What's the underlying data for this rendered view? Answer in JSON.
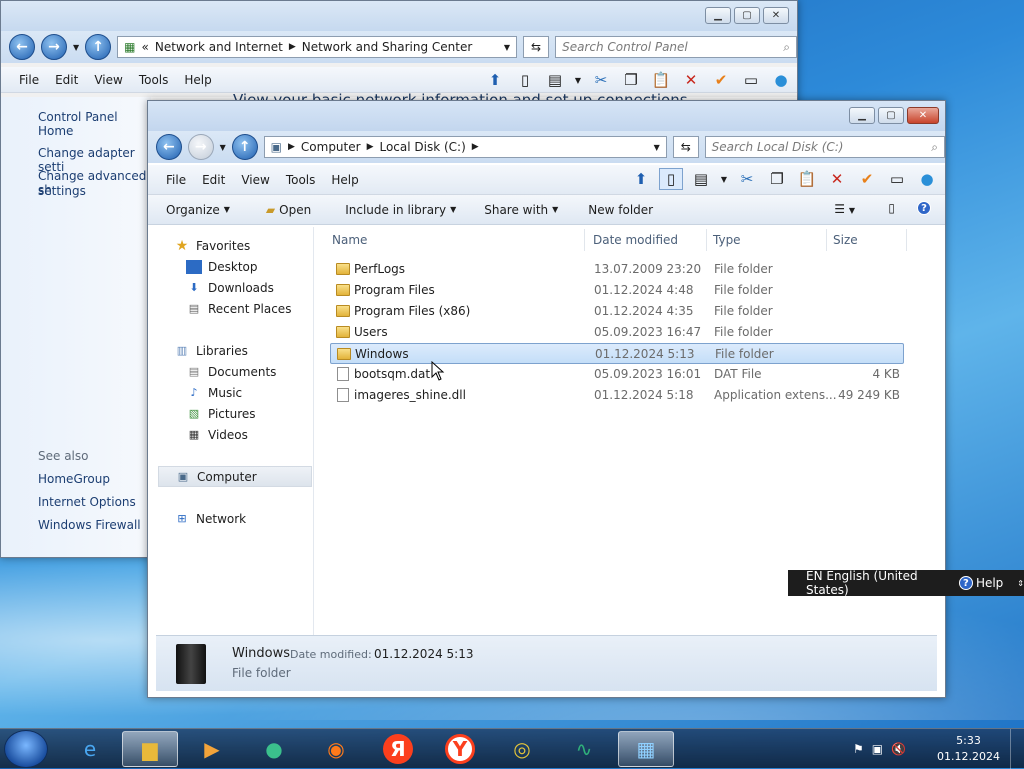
{
  "control_panel": {
    "breadcrumb": [
      "Network and Internet",
      "Network and Sharing Center"
    ],
    "breadcrumb_prefix": "«",
    "search_placeholder": "Search Control Panel",
    "menu": [
      "File",
      "Edit",
      "View",
      "Tools",
      "Help"
    ],
    "heading_partial": "View your basic network information and set up connections",
    "left_links": [
      "Control Panel Home",
      "Change adapter setti",
      "Change advanced sh",
      "settings"
    ],
    "see_also_label": "See also",
    "see_also": [
      "HomeGroup",
      "Internet Options",
      "Windows Firewall"
    ]
  },
  "explorer": {
    "breadcrumb": [
      "Computer",
      "Local Disk (C:)"
    ],
    "search_placeholder": "Search Local Disk (C:)",
    "menu": [
      "File",
      "Edit",
      "View",
      "Tools",
      "Help"
    ],
    "commands": {
      "organize": "Organize",
      "open": "Open",
      "include": "Include in library",
      "share": "Share with",
      "new_folder": "New folder"
    },
    "nav": {
      "favorites": "Favorites",
      "desktop": "Desktop",
      "downloads": "Downloads",
      "recent": "Recent Places",
      "libraries": "Libraries",
      "documents": "Documents",
      "music": "Music",
      "pictures": "Pictures",
      "videos": "Videos",
      "computer": "Computer",
      "network": "Network"
    },
    "columns": {
      "name": "Name",
      "date": "Date modified",
      "type": "Type",
      "size": "Size"
    },
    "files": [
      {
        "name": "PerfLogs",
        "date": "13.07.2009 23:20",
        "type": "File folder",
        "size": "",
        "kind": "folder"
      },
      {
        "name": "Program Files",
        "date": "01.12.2024 4:48",
        "type": "File folder",
        "size": "",
        "kind": "folder"
      },
      {
        "name": "Program Files (x86)",
        "date": "01.12.2024 4:35",
        "type": "File folder",
        "size": "",
        "kind": "folder"
      },
      {
        "name": "Users",
        "date": "05.09.2023 16:47",
        "type": "File folder",
        "size": "",
        "kind": "folder"
      },
      {
        "name": "Windows",
        "date": "01.12.2024 5:13",
        "type": "File folder",
        "size": "",
        "kind": "folder"
      },
      {
        "name": "bootsqm.dat",
        "date": "05.09.2023 16:01",
        "type": "DAT File",
        "size": "4 KB",
        "kind": "file"
      },
      {
        "name": "imageres_shine.dll",
        "date": "01.12.2024 5:18",
        "type": "Application extens...",
        "size": "49 249 KB",
        "kind": "file"
      }
    ],
    "details": {
      "name": "Windows",
      "date_label": "Date modified:",
      "date": "01.12.2024 5:13",
      "type": "File folder"
    }
  },
  "language_bar": {
    "lang": "EN English (United States)",
    "help": "Help"
  },
  "taskbar": {
    "time": "5:33",
    "date": "01.12.2024",
    "apps": [
      "internet-explorer-icon",
      "explorer-icon",
      "media-player-icon",
      "globe-icon",
      "firefox-icon",
      "yandex-icon",
      "yandex-browser-icon",
      "chrome-icon",
      "snake-icon",
      "control-panel-icon"
    ],
    "yandex_letter": "Я",
    "yandex_browser_letter": "Y"
  },
  "colors": {
    "selection": "#cce4fb",
    "link": "#1c3e72"
  }
}
